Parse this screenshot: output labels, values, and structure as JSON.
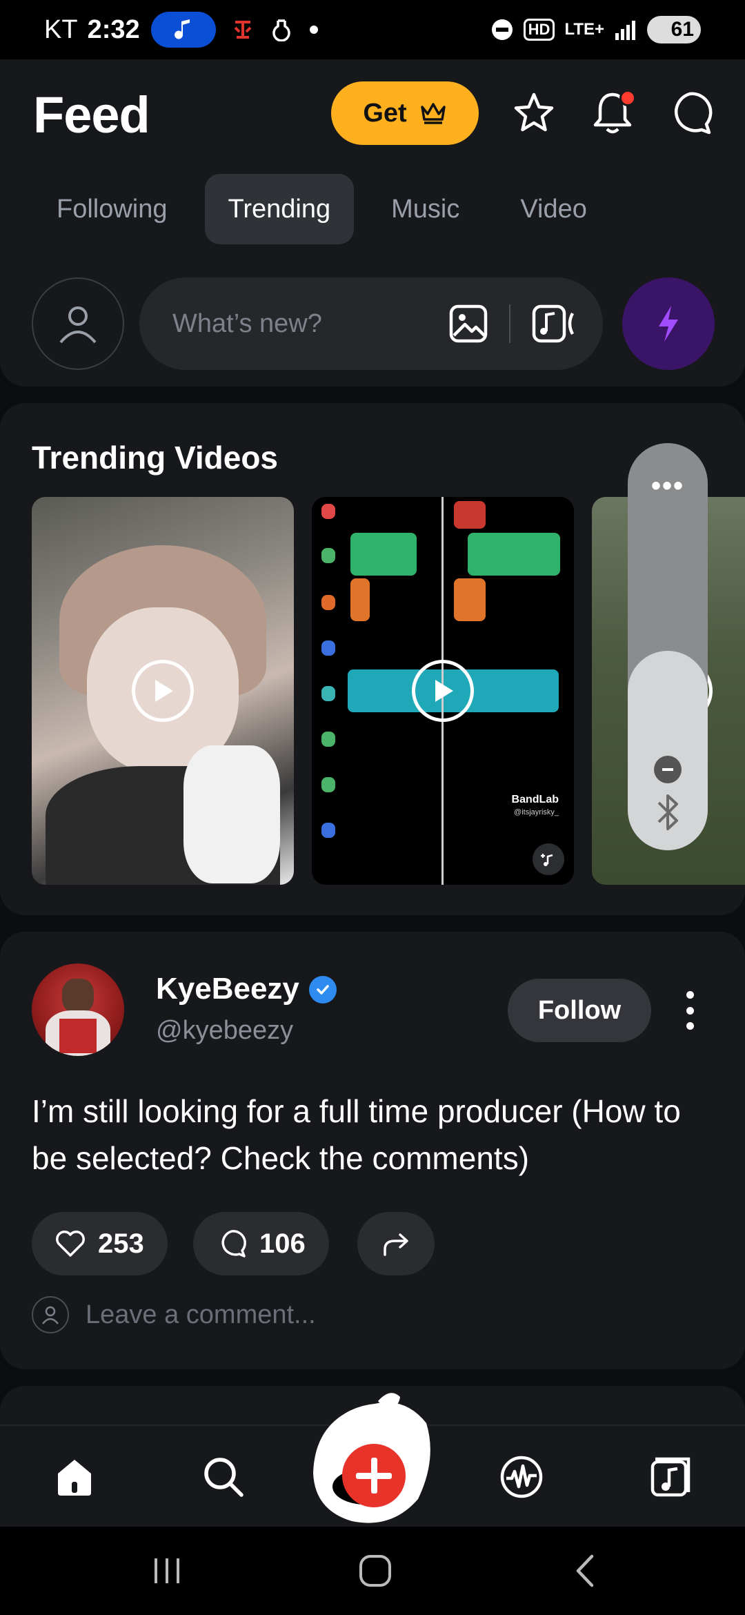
{
  "status_bar": {
    "carrier": "KT",
    "time": "2:32",
    "network": "LTE+",
    "hd_label": "HD",
    "battery": "61"
  },
  "header": {
    "title": "Feed",
    "get_label": "Get"
  },
  "tabs": [
    {
      "label": "Following",
      "active": false
    },
    {
      "label": "Trending",
      "active": true
    },
    {
      "label": "Music",
      "active": false
    },
    {
      "label": "Video",
      "active": false
    }
  ],
  "composer": {
    "placeholder": "What’s new?"
  },
  "trending": {
    "title": "Trending Videos",
    "watermark_brand": "BandLab",
    "watermark_handle": "@itsjayrisky_"
  },
  "volume_overlay": {
    "more_label": "•••",
    "level": 0.49
  },
  "post": {
    "author_name": "KyeBeezy",
    "author_handle": "@kyebeezy",
    "verified": true,
    "follow_label": "Follow",
    "text": "I’m still looking for a full time producer (How to be selected? Check the comments)",
    "likes": "253",
    "comments": "106",
    "comment_placeholder": "Leave a comment..."
  },
  "colors": {
    "accent_get": "#ffb01f",
    "boost_bg": "#3a1466",
    "boost_bolt": "#a24cff",
    "create_red": "#e8332b",
    "verified_blue": "#2e8cf0",
    "notification_dot": "#ff3b30"
  },
  "icons": {
    "header": [
      "crown-icon",
      "star-icon",
      "bell-icon",
      "chat-bubble-icon"
    ],
    "nav": [
      "home-icon",
      "search-icon",
      "create-plus-icon",
      "waveform-icon",
      "music-library-icon"
    ]
  }
}
